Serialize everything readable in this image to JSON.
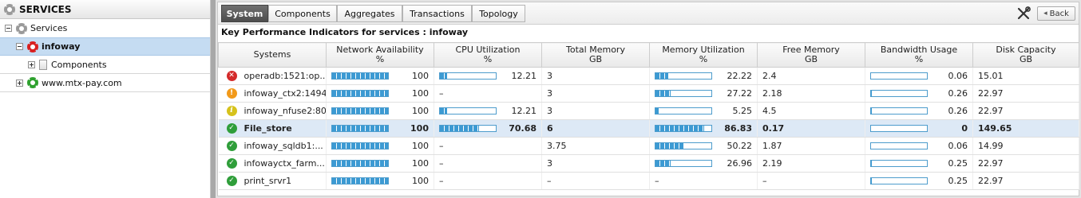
{
  "tree": {
    "header": "SERVICES",
    "items": [
      {
        "label": "Services",
        "toggle": "minus",
        "icon": "grey-gear-icon",
        "indent": 1
      },
      {
        "label": "infoway",
        "toggle": "minus",
        "icon": "red-gear-icon",
        "indent": 2,
        "selected": true
      },
      {
        "label": "Components",
        "toggle": "plus",
        "icon": "document-icon",
        "indent": 3
      },
      {
        "label": "www.mtx-pay.com",
        "toggle": "plus",
        "icon": "green-gear-icon",
        "indent": 1
      }
    ]
  },
  "tabs": [
    {
      "label": "System",
      "active": true
    },
    {
      "label": "Components",
      "active": false
    },
    {
      "label": "Aggregates",
      "active": false
    },
    {
      "label": "Transactions",
      "active": false
    },
    {
      "label": "Topology",
      "active": false
    }
  ],
  "toolbar": {
    "back_label": "Back",
    "tools_icon": "wrench-screwdriver-icon"
  },
  "kpi_title": "Key Performance Indicators for services : infoway",
  "columns": [
    {
      "line1": "Systems",
      "line2": ""
    },
    {
      "line1": "Network Availability",
      "line2": "%"
    },
    {
      "line1": "CPU Utilization",
      "line2": "%"
    },
    {
      "line1": "Total Memory",
      "line2": "GB"
    },
    {
      "line1": "Memory Utilization",
      "line2": "%"
    },
    {
      "line1": "Free Memory",
      "line2": "GB"
    },
    {
      "line1": "Bandwidth Usage",
      "line2": "%"
    },
    {
      "line1": "Disk Capacity",
      "line2": "GB"
    }
  ],
  "rows": [
    {
      "status": "critical",
      "status_icon": "critical-x-icon",
      "name": "operadb:1521:op...",
      "net_avail": 100,
      "net_text": "100",
      "cpu": 12.21,
      "cpu_text": "12.21",
      "total_mem": "3",
      "mem_util": 22.22,
      "mem_text": "22.22",
      "free_mem": "2.4",
      "bandwidth": 0.06,
      "bw_text": "0.06",
      "disk": "15.01"
    },
    {
      "status": "major",
      "status_icon": "major-exclamation-icon",
      "name": "infoway_ctx2:1494",
      "net_avail": 100,
      "net_text": "100",
      "cpu": null,
      "cpu_text": "–",
      "total_mem": "3",
      "mem_util": 27.22,
      "mem_text": "27.22",
      "free_mem": "2.18",
      "bandwidth": 0.26,
      "bw_text": "0.26",
      "disk": "22.97"
    },
    {
      "status": "minor",
      "status_icon": "minor-info-icon",
      "name": "infoway_nfuse2:80",
      "net_avail": 100,
      "net_text": "100",
      "cpu": 12.21,
      "cpu_text": "12.21",
      "total_mem": "3",
      "mem_util": 5.25,
      "mem_text": "5.25",
      "free_mem": "4.5",
      "bandwidth": 0.26,
      "bw_text": "0.26",
      "disk": "22.97"
    },
    {
      "status": "normal",
      "status_icon": "normal-check-icon",
      "name": "File_store",
      "net_avail": 100,
      "net_text": "100",
      "cpu": 70.68,
      "cpu_text": "70.68",
      "total_mem": "6",
      "mem_util": 86.83,
      "mem_text": "86.83",
      "free_mem": "0.17",
      "bandwidth": 0,
      "bw_text": "0",
      "disk": "149.65",
      "highlight": true
    },
    {
      "status": "normal",
      "status_icon": "normal-check-icon",
      "name": "infoway_sqldb1:...",
      "net_avail": 100,
      "net_text": "100",
      "cpu": null,
      "cpu_text": "–",
      "total_mem": "3.75",
      "mem_util": 50.22,
      "mem_text": "50.22",
      "free_mem": "1.87",
      "bandwidth": 0.06,
      "bw_text": "0.06",
      "disk": "14.99"
    },
    {
      "status": "normal",
      "status_icon": "normal-check-icon",
      "name": "infowayctx_farm...",
      "net_avail": 100,
      "net_text": "100",
      "cpu": null,
      "cpu_text": "–",
      "total_mem": "3",
      "mem_util": 26.96,
      "mem_text": "26.96",
      "free_mem": "2.19",
      "bandwidth": 0.25,
      "bw_text": "0.25",
      "disk": "22.97"
    },
    {
      "status": "normal",
      "status_icon": "normal-check-icon",
      "name": "print_srvr1",
      "net_avail": 100,
      "net_text": "100",
      "cpu": null,
      "cpu_text": "–",
      "total_mem": "–",
      "mem_util": null,
      "mem_text": "–",
      "free_mem": "–",
      "bandwidth": 0.25,
      "bw_text": "0.25",
      "disk": "22.97"
    }
  ],
  "colors": {
    "bar_fill": "#3c9ad3",
    "bar_border": "#4d9ccc",
    "critical": "#d42a2a",
    "major": "#f29a1a",
    "minor": "#d6c21c",
    "normal": "#2f9e3a",
    "selected_row": "#dde9f6"
  }
}
